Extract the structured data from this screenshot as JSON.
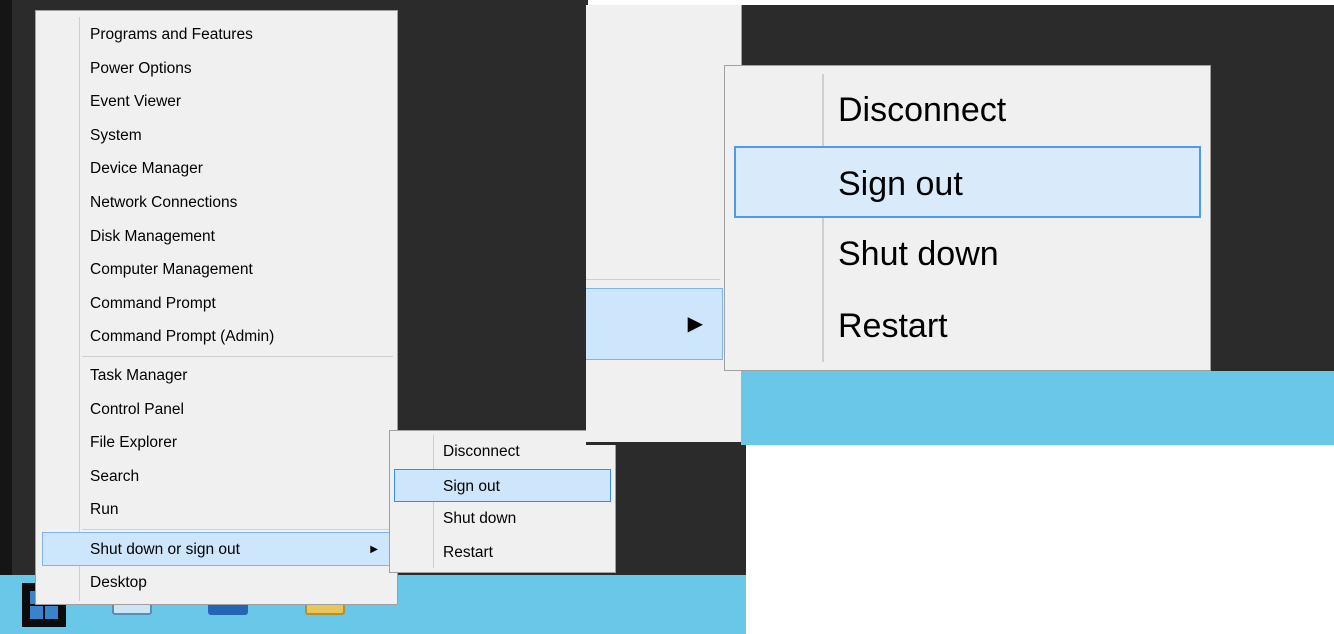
{
  "winx_menu": {
    "group1": [
      "Programs and Features",
      "Power Options",
      "Event Viewer",
      "System",
      "Device Manager",
      "Network Connections",
      "Disk Management",
      "Computer Management",
      "Command Prompt",
      "Command Prompt (Admin)"
    ],
    "group2": [
      "Task Manager",
      "Control Panel",
      "File Explorer",
      "Search",
      "Run"
    ],
    "shutdown_item": "Shut down or sign out",
    "desktop_item": "Desktop"
  },
  "submenu": {
    "items": [
      "Disconnect",
      "Sign out",
      "Shut down",
      "Restart"
    ],
    "highlighted": "Sign out"
  },
  "icons": {
    "submenu_arrow": "chevron-right-icon",
    "start": "windows-logo-icon",
    "taskbar": [
      "server-manager-icon",
      "powershell-icon",
      "file-explorer-icon"
    ]
  },
  "colors": {
    "menu_bg": "#f0f0f0",
    "highlight_bg": "#cde6fb",
    "highlight_border": "#3a8de0",
    "taskbar": "#69c7e7",
    "desktop": "#2b2b2b"
  }
}
